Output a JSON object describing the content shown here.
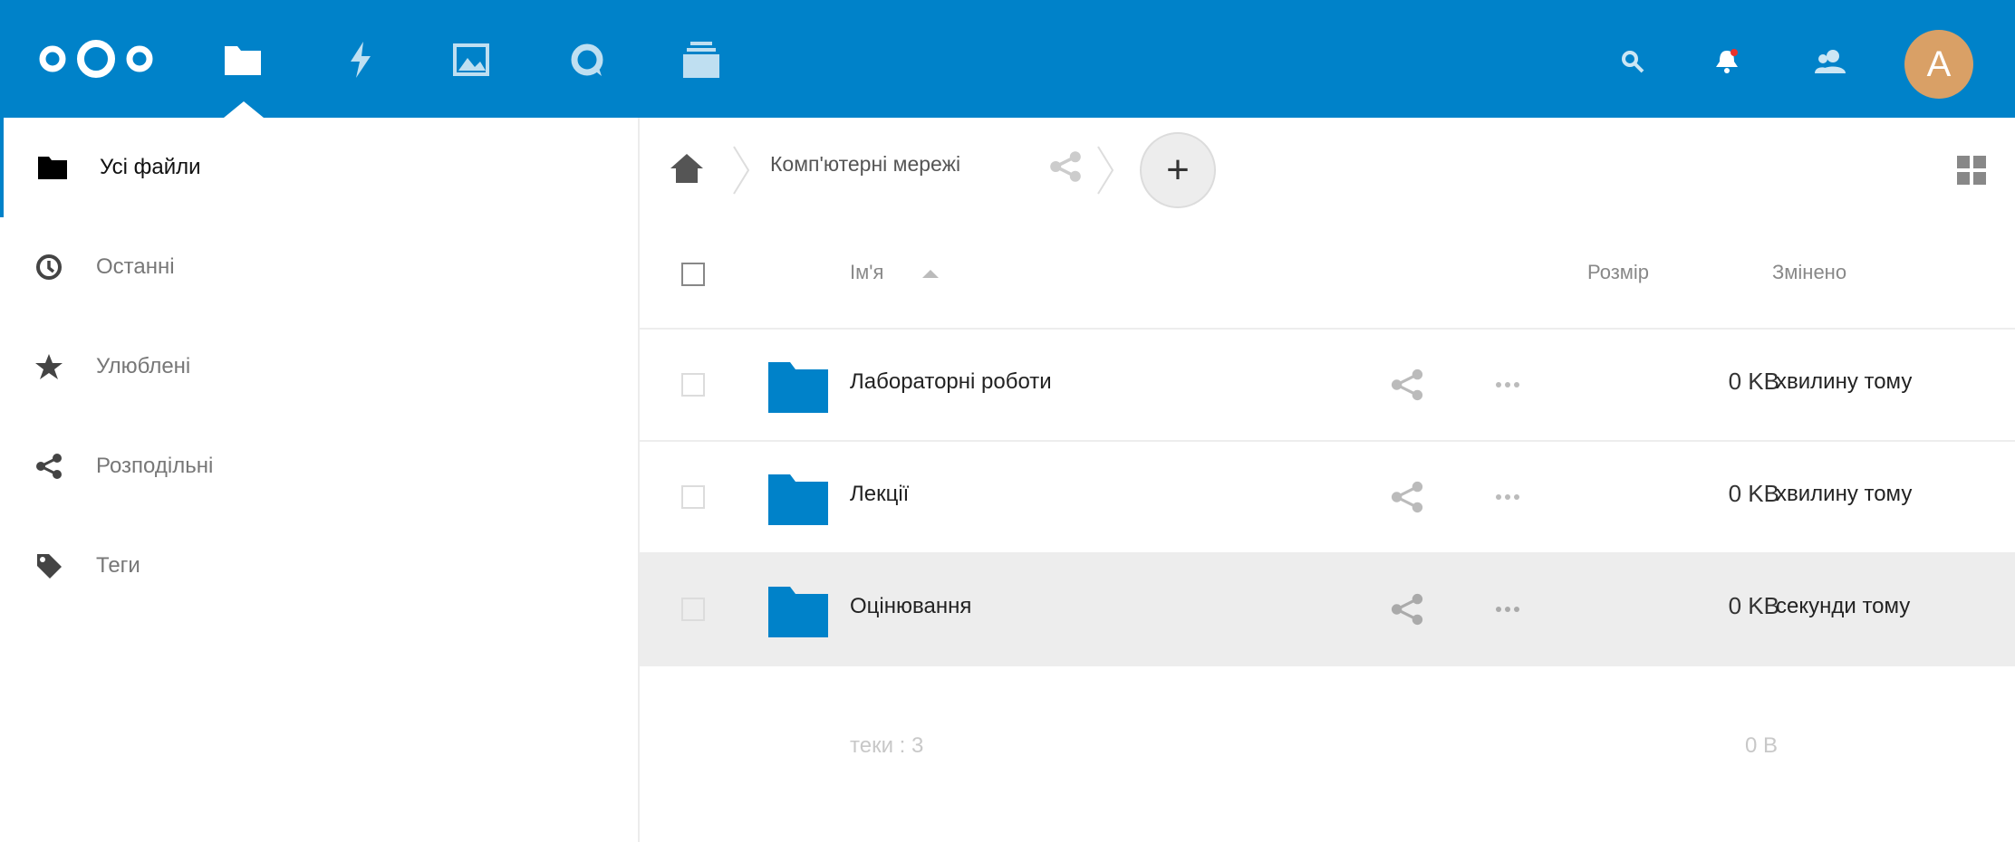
{
  "header": {
    "apps": [
      {
        "icon": "files-folder-icon"
      },
      {
        "icon": "activity-bolt-icon"
      },
      {
        "icon": "gallery-image-icon"
      },
      {
        "icon": "talk-chat-icon"
      },
      {
        "icon": "deck-stack-icon"
      }
    ],
    "right_icons": [
      "search-icon",
      "notifications-bell-icon",
      "contacts-icon"
    ],
    "avatar_letter": "A",
    "brand_color": "#0082c9",
    "avatar_color": "#d9a066"
  },
  "sidebar": {
    "items": [
      {
        "label": "Усі файли",
        "icon": "folder-icon",
        "active": true
      },
      {
        "label": "Останні",
        "icon": "clock-icon"
      },
      {
        "label": "Улюблені",
        "icon": "star-icon"
      },
      {
        "label": "Розподільні",
        "icon": "share-icon"
      },
      {
        "label": "Теги",
        "icon": "tag-icon"
      }
    ]
  },
  "breadcrumb": {
    "folder": "Комп'ютерні мережі",
    "add_label": "+"
  },
  "table": {
    "columns": {
      "name": "Ім'я",
      "size": "Розмір",
      "modified": "Змінено"
    },
    "rows": [
      {
        "name": "Лабораторні роботи",
        "size": "0 KB",
        "modified": "хвилину тому"
      },
      {
        "name": "Лекції",
        "size": "0 KB",
        "modified": "хвилину тому"
      },
      {
        "name": "Оцінювання",
        "size": "0 KB",
        "modified": "секунди тому",
        "highlighted": true
      }
    ],
    "summary": {
      "label": "теки : 3",
      "size": "0 B"
    }
  }
}
